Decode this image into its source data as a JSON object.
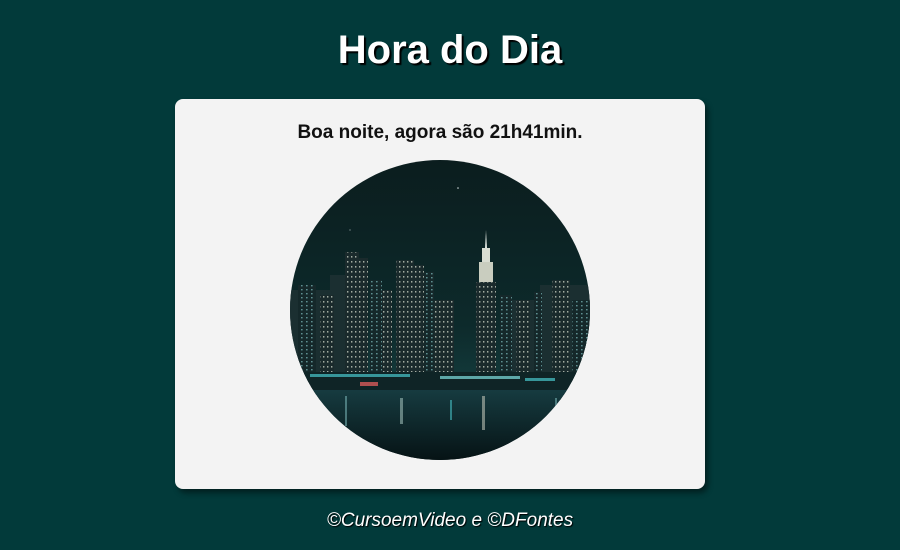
{
  "header": {
    "title": "Hora do Dia"
  },
  "card": {
    "greeting": "Boa noite, agora são 21h41min.",
    "image": {
      "subject": "night-city-skyline",
      "shape": "circle"
    }
  },
  "footer": {
    "credits": "©CursoemVideo e ©DFontes"
  },
  "colors": {
    "background": "#023a3a",
    "card": "#f3f3f3",
    "title_text": "#ffffff",
    "greeting_text": "#111111"
  }
}
